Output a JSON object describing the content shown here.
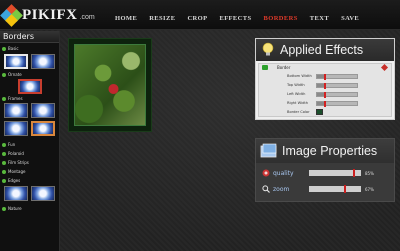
{
  "logo": {
    "name": "PIKIFX",
    "domain": ".com"
  },
  "nav": [
    "HOME",
    "RESIZE",
    "CROP",
    "EFFECTS",
    "BORDERS",
    "TEXT",
    "SAVE"
  ],
  "nav_active": "BORDERS",
  "sidebar": {
    "title": "Borders",
    "categories": [
      "Basic",
      "Ornate",
      "Frames",
      "Fun",
      "Polaroid",
      "Film Strips",
      "Montage",
      "Edges",
      "Nature"
    ]
  },
  "effects_panel": {
    "title": "Applied Effects",
    "effect_name": "Border",
    "params": [
      {
        "label": "Bottom Width",
        "value": 0.18
      },
      {
        "label": "Top Width",
        "value": 0.18
      },
      {
        "label": "Left Width",
        "value": 0.18
      },
      {
        "label": "Right Width",
        "value": 0.18
      },
      {
        "label": "Border Color",
        "swatch": "#1c4f2c"
      }
    ]
  },
  "props_panel": {
    "title": "Image Properties",
    "props": [
      {
        "label": "quality",
        "value": "85%",
        "level": 0.85
      },
      {
        "label": "zoom",
        "value": "67%",
        "level": 0.67
      }
    ]
  },
  "colors": {
    "accent": "#e23a2a",
    "panel_bg": "#efefef",
    "sidebar_dot": "#59b93d"
  }
}
